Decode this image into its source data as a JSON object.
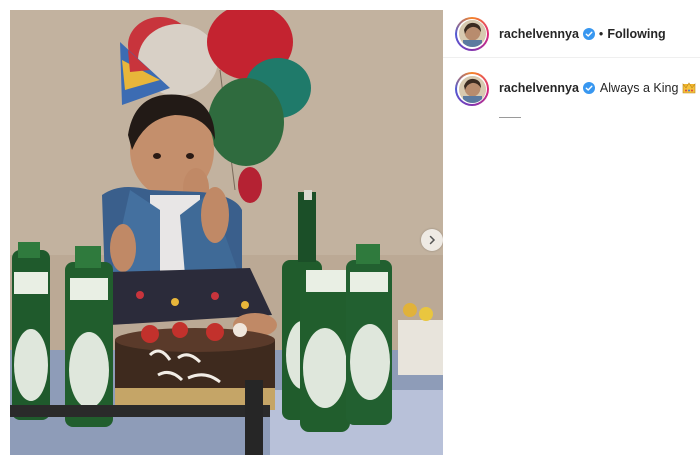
{
  "post": {
    "author": {
      "username": "rachelvennya",
      "verified": true,
      "avatar": "avatar-photo"
    },
    "header": {
      "separator": "•",
      "follow_status": "Following"
    },
    "caption": {
      "username": "rachelvennya",
      "text": "Always a King",
      "emoji": "crown-emoji"
    },
    "media": {
      "description_icon": "photo",
      "carousel_next_icon": "chevron-right-icon"
    }
  },
  "colors": {
    "verified_badge": "#3897f0",
    "text_primary": "#262626",
    "divider": "#efefef",
    "story_ring": [
      "#f58529",
      "#dd2a7b",
      "#8134af",
      "#515bd4"
    ]
  }
}
